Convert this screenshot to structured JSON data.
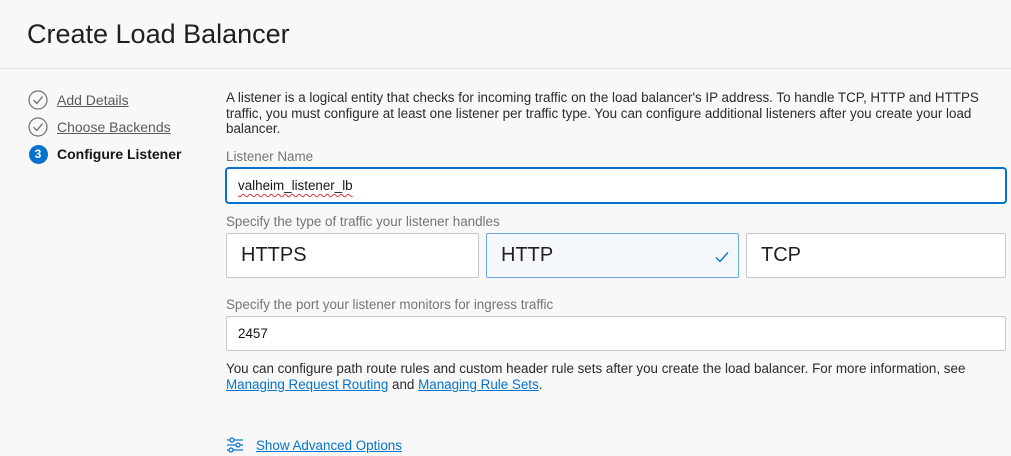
{
  "header": {
    "title": "Create Load Balancer"
  },
  "steps": [
    {
      "label": "Add Details",
      "state": "complete"
    },
    {
      "label": "Choose Backends",
      "state": "complete"
    },
    {
      "label": "Configure Listener",
      "state": "current",
      "number": "3"
    }
  ],
  "listener": {
    "intro": "A listener is a logical entity that checks for incoming traffic on the load balancer's IP address. To handle TCP, HTTP and HTTPS traffic, you must configure at least one listener per traffic type. You can configure additional listeners after you create your load balancer.",
    "name_label": "Listener Name",
    "name_value": "valheim_listener_lb",
    "traffic_label": "Specify the type of traffic your listener handles",
    "traffic_options": [
      "HTTPS",
      "HTTP",
      "TCP"
    ],
    "traffic_selected": "HTTP",
    "port_label": "Specify the port your listener monitors for ingress traffic",
    "port_value": "2457",
    "footnote_text": "You can configure path route rules and custom header rule sets after you create the load balancer. For more information, see",
    "footnote_link1": "Managing Request Routing",
    "footnote_and": "and",
    "footnote_link2": "Managing Rule Sets",
    "footnote_end": ".",
    "advanced_label": "Show Advanced Options"
  },
  "colors": {
    "accent": "#0572ce",
    "selected_bg": "#f4f8fc",
    "spellcheck": "#d43a3a"
  },
  "icons": {
    "complete_step": "check-circle-icon",
    "advanced": "sliders-icon",
    "selected": "checkmark-icon"
  }
}
